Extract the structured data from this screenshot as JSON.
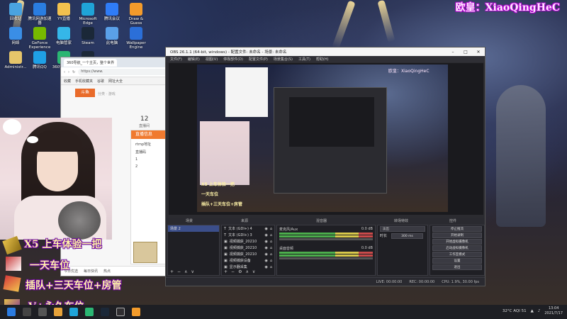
{
  "overlay": {
    "top_label": "欧皇：XiaoQingHeC",
    "captions": [
      "X5 上车体验一把",
      "一天车位",
      "插队+三天车位+房管",
      "V+永久车位"
    ]
  },
  "desktop_icons": [
    {
      "label": "回收站",
      "color": "#4aa3e0"
    },
    {
      "label": "腾讯网游加速器",
      "color": "#2a7de1"
    },
    {
      "label": "YY直播",
      "color": "#f2c14e"
    },
    {
      "label": "Microsoft Edge",
      "color": "#1fa4d8"
    },
    {
      "label": "腾讯会议",
      "color": "#2f7cf6"
    },
    {
      "label": "Draw & Guess",
      "color": "#f39b2b"
    },
    {
      "label": "网络",
      "color": "#3a8ee6"
    },
    {
      "label": "GeForce Experience",
      "color": "#76b900"
    },
    {
      "label": "电脑管家",
      "color": "#35b6e8"
    },
    {
      "label": "Steam",
      "color": "#1b2838"
    },
    {
      "label": "此电脑",
      "color": "#5aa0e8"
    },
    {
      "label": "Wallpaper Engine",
      "color": "#2b6fd8"
    },
    {
      "label": "Administr...",
      "color": "#e6c56a"
    },
    {
      "label": "腾讯QQ",
      "color": "#1fa0e6"
    },
    {
      "label": "360安全浏览器",
      "color": "#2bb673"
    },
    {
      "label": "Steam",
      "color": "#1b2838"
    }
  ],
  "browser": {
    "tab": "360导航_一个主页，整个世界",
    "url": "https://www.",
    "bookmarks": [
      "收藏",
      "手机收藏夹",
      "谷歌",
      "网址大全"
    ],
    "logo": "斗鱼",
    "nav": "分类 · 游戏",
    "number": "12",
    "number_label": "直播间",
    "panel_title": "直播信息",
    "panel_lines": [
      "rtmp地址",
      "直播码",
      "1",
      "2"
    ],
    "status": [
      "今日优选",
      "每日快讯",
      "热点"
    ]
  },
  "obs": {
    "title": "OBS 26.1.1 (64-bit, windows) - 配置文件: 未命名 - 场景: 未命名",
    "menu": [
      "文件(F)",
      "编辑(E)",
      "视图(V)",
      "停靠部件(D)",
      "配置文件(P)",
      "场景集合(S)",
      "工具(T)",
      "帮助(H)"
    ],
    "window_controls": [
      "–",
      "□",
      "✕"
    ],
    "docks": {
      "scenes": "场景",
      "sources": "来源",
      "mixer": "混音器",
      "transitions": "转场特效",
      "controls": "控件"
    },
    "scene_items": [
      "场景 2"
    ],
    "source_items": [
      "文本 (GDI+) 4",
      "文本 (GDI+) 3",
      "视频捕获_20210",
      "视频捕获_20210",
      "视频捕获_20210",
      "视频捕获设备",
      "显示器采集"
    ],
    "mixer_channels": [
      {
        "name": "麦克风/Aux",
        "value": "0.0 dB"
      },
      {
        "name": "桌面音频",
        "value": "0.0 dB"
      }
    ],
    "transition": {
      "type": "淡出",
      "duration_label": "时长",
      "duration": "300 ms"
    },
    "control_buttons": [
      "停止推流",
      "开始录制",
      "开始虚拟摄像机",
      "启动虚拟摄像机",
      "工作室模式",
      "设置",
      "退出"
    ],
    "status": [
      "LIVE: 00:00:00",
      "REC: 00:00:00",
      "CPU: 1.9%, 30.00 fps"
    ],
    "add_remove": [
      "+",
      "−",
      "∧",
      "∨"
    ]
  },
  "taskbar": {
    "weather": "32°C  AQI 51",
    "time": "13:04",
    "date": "2021/7/17"
  }
}
